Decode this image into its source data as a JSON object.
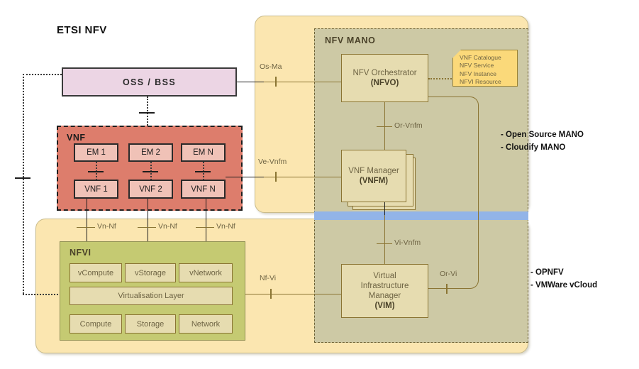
{
  "title": "ETSI NFV",
  "oss": {
    "label": "OSS / BSS"
  },
  "vnf_region": {
    "title": "VNF",
    "ems": [
      "EM 1",
      "EM 2",
      "EM  N"
    ],
    "vnfs": [
      "VNF 1",
      "VNF 2",
      "VNF N"
    ]
  },
  "nfvi_region": {
    "title": "NFVI",
    "virtual_resources": [
      "vCompute",
      "vStorage",
      "vNetwork"
    ],
    "virtualisation_layer": "Virtualisation Layer",
    "hardware_resources": [
      "Compute",
      "Storage",
      "Network"
    ]
  },
  "mano": {
    "title": "NFV MANO",
    "nfvo": {
      "line1": "NFV Orchestrator",
      "line2": "(NFVO)"
    },
    "vnfm": {
      "line1": "VNF Manager",
      "line2": "(VNFM)"
    },
    "vim": {
      "line1": "Virtual",
      "line2": "Infrastructure",
      "line3": "Manager",
      "line4": "(VIM)"
    },
    "catalogue": [
      "VNF Catalogue",
      "NFV Service",
      "NFV Instance",
      "NFVI Resource"
    ]
  },
  "reference_points": {
    "os_ma": "Os-Ma",
    "ve_vnfm": "Ve-Vnfm",
    "or_vnfm": "Or-Vnfm",
    "vi_vnfm": "Vi-Vnfm",
    "nf_vi": "Nf-Vi",
    "or_vi": "Or-Vi",
    "vn_nf": [
      "Vn-Nf",
      "Vn-Nf",
      "Vn-Nf"
    ]
  },
  "annotations": {
    "mano_impls": [
      "- Open Source MANO",
      "- Cloudify MANO"
    ],
    "nfvi_impls": [
      "- OPNFV",
      "- VMWare vCloud"
    ]
  },
  "colors": {
    "vnf_region": "#dd7d6c",
    "nfvi_region": "#c5ca72",
    "container_yellow": "#fbe6b0",
    "mano_region": "#cdc9a5",
    "block": "#e6dcb0",
    "oss": "#ecd5e4",
    "catalogue": "#fbd97a",
    "blue_band": "#92b4e8",
    "line": "#8a7433"
  }
}
